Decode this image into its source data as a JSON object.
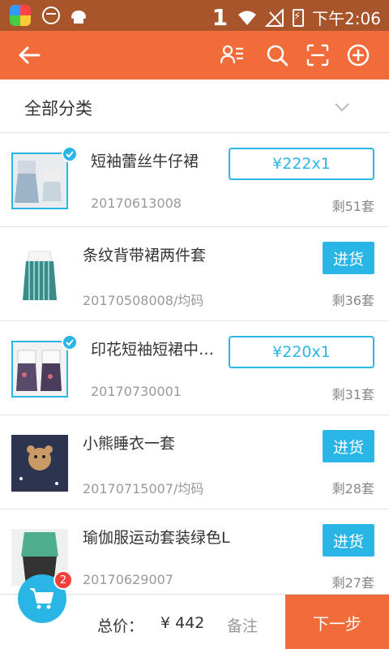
{
  "status_bar": {
    "sim_label": "1",
    "time": "下午2:06"
  },
  "toolbar": {
    "back_icon": "back-arrow-icon",
    "icons": [
      "contacts-list-icon",
      "search-icon",
      "scan-icon",
      "add-circle-icon"
    ]
  },
  "category": {
    "label": "全部分类",
    "icon": "chevron-down-icon"
  },
  "items": [
    {
      "title": "短袖蕾丝牛仔裙",
      "code": "20170613008",
      "stock": "剩51套",
      "selected": true,
      "qty": "¥222x1"
    },
    {
      "title": "条纹背带裙两件套",
      "code": "20170508008/均码",
      "stock": "剩36套",
      "selected": false,
      "action": "进货"
    },
    {
      "title": "印花短袖短裙中…",
      "code": "20170730001",
      "stock": "剩31套",
      "selected": true,
      "qty": "¥220x1"
    },
    {
      "title": "小熊睡衣一套",
      "code": "20170715007/均码",
      "stock": "剩28套",
      "selected": false,
      "action": "进货"
    },
    {
      "title": "瑜伽服运动套装绿色L",
      "code": "20170629007",
      "stock": "剩27套",
      "selected": false,
      "action": "进货"
    }
  ],
  "bottom": {
    "total_label": "总价：",
    "total_value": "¥ 442",
    "note_label": "备注",
    "next_label": "下一步",
    "cart_count": "2"
  },
  "colors": {
    "accent": "#f26b3a",
    "blue": "#29b6e6",
    "status_bar": "#a9552b"
  }
}
